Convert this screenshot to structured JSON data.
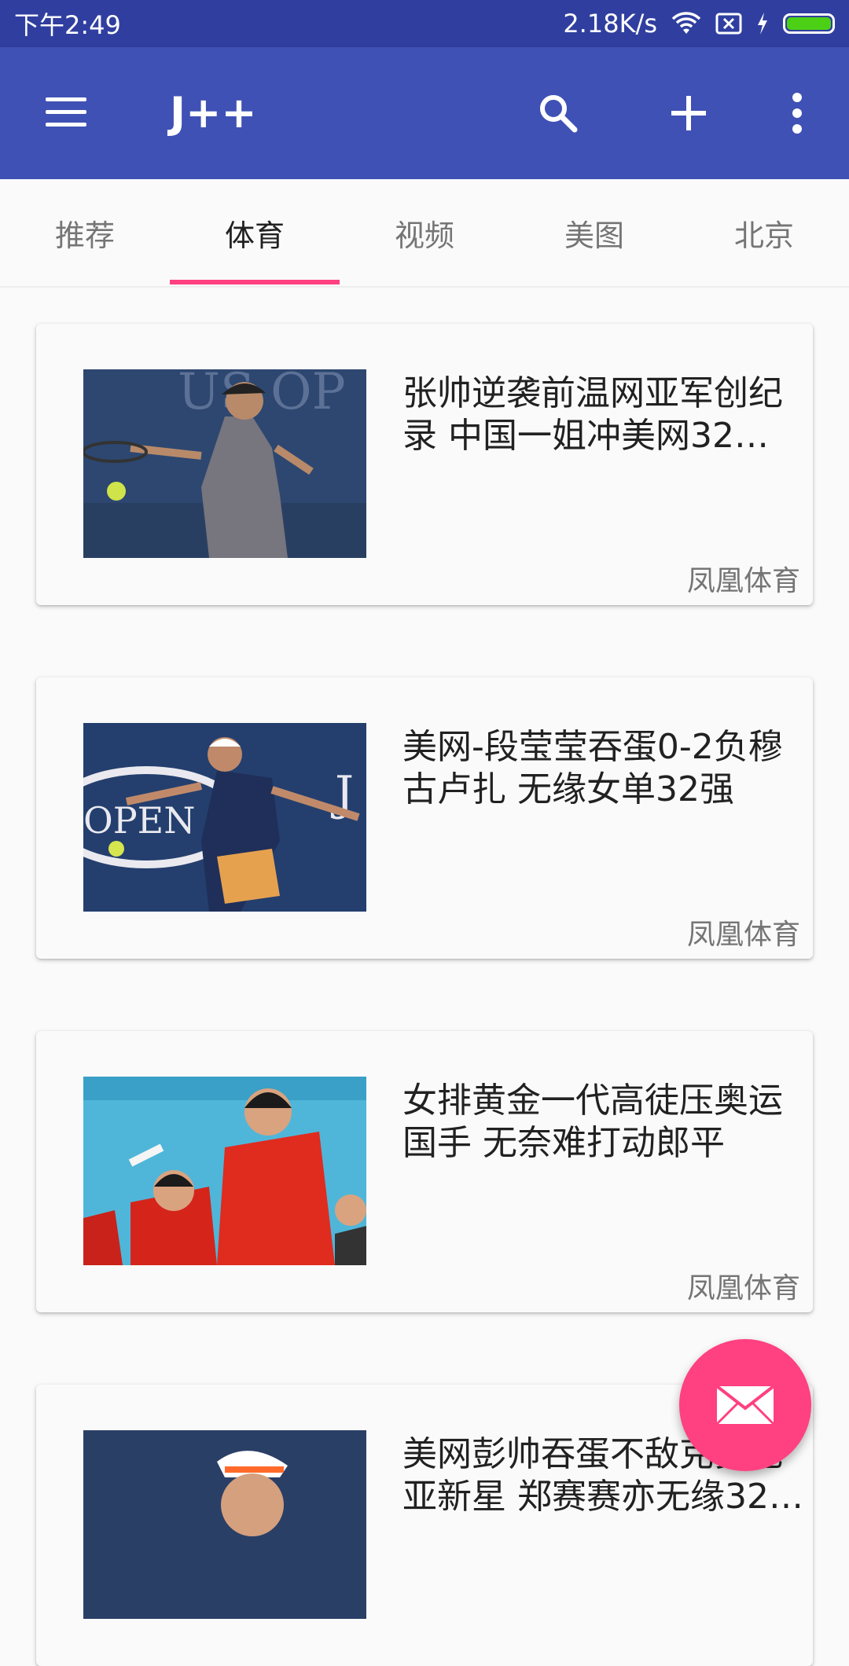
{
  "status_bar": {
    "time": "下午2:49",
    "network_speed": "2.18K/s",
    "icons": [
      "wifi-icon",
      "sim-icon",
      "charging-icon",
      "battery-icon"
    ],
    "battery_color": "#4cd016"
  },
  "app_bar": {
    "title": "J++",
    "background": "#3f51b5",
    "icons": [
      "menu-icon",
      "search-icon",
      "add-icon",
      "more-vert-icon"
    ]
  },
  "tabs": {
    "items": [
      {
        "label": "推荐"
      },
      {
        "label": "体育"
      },
      {
        "label": "视频"
      },
      {
        "label": "美图"
      },
      {
        "label": "北京"
      }
    ],
    "selected": "体育",
    "indicator_color": "#ff4081"
  },
  "news": [
    {
      "title": "张帅逆袭前温网亚军创纪录  中国一姐冲美网32…",
      "source": "凤凰体育",
      "image": "tennis-player-us-open-photo"
    },
    {
      "title": "美网-段莹莹吞蛋0-2负穆古卢扎 无缘女单32强",
      "source": "凤凰体育",
      "image": "tennis-player-forehand-photo"
    },
    {
      "title": "女排黄金一代高徒压奥运国手 无奈难打动郎平",
      "source": "凤凰体育",
      "image": "volleyball-team-celebration-photo"
    },
    {
      "title": "美网彭帅吞蛋不敌克罗地亚新星 郑赛赛亦无缘32…",
      "source": "",
      "image": "tennis-player-visor-photo"
    }
  ],
  "fab": {
    "icon": "mail-icon",
    "color": "#ff4081"
  }
}
